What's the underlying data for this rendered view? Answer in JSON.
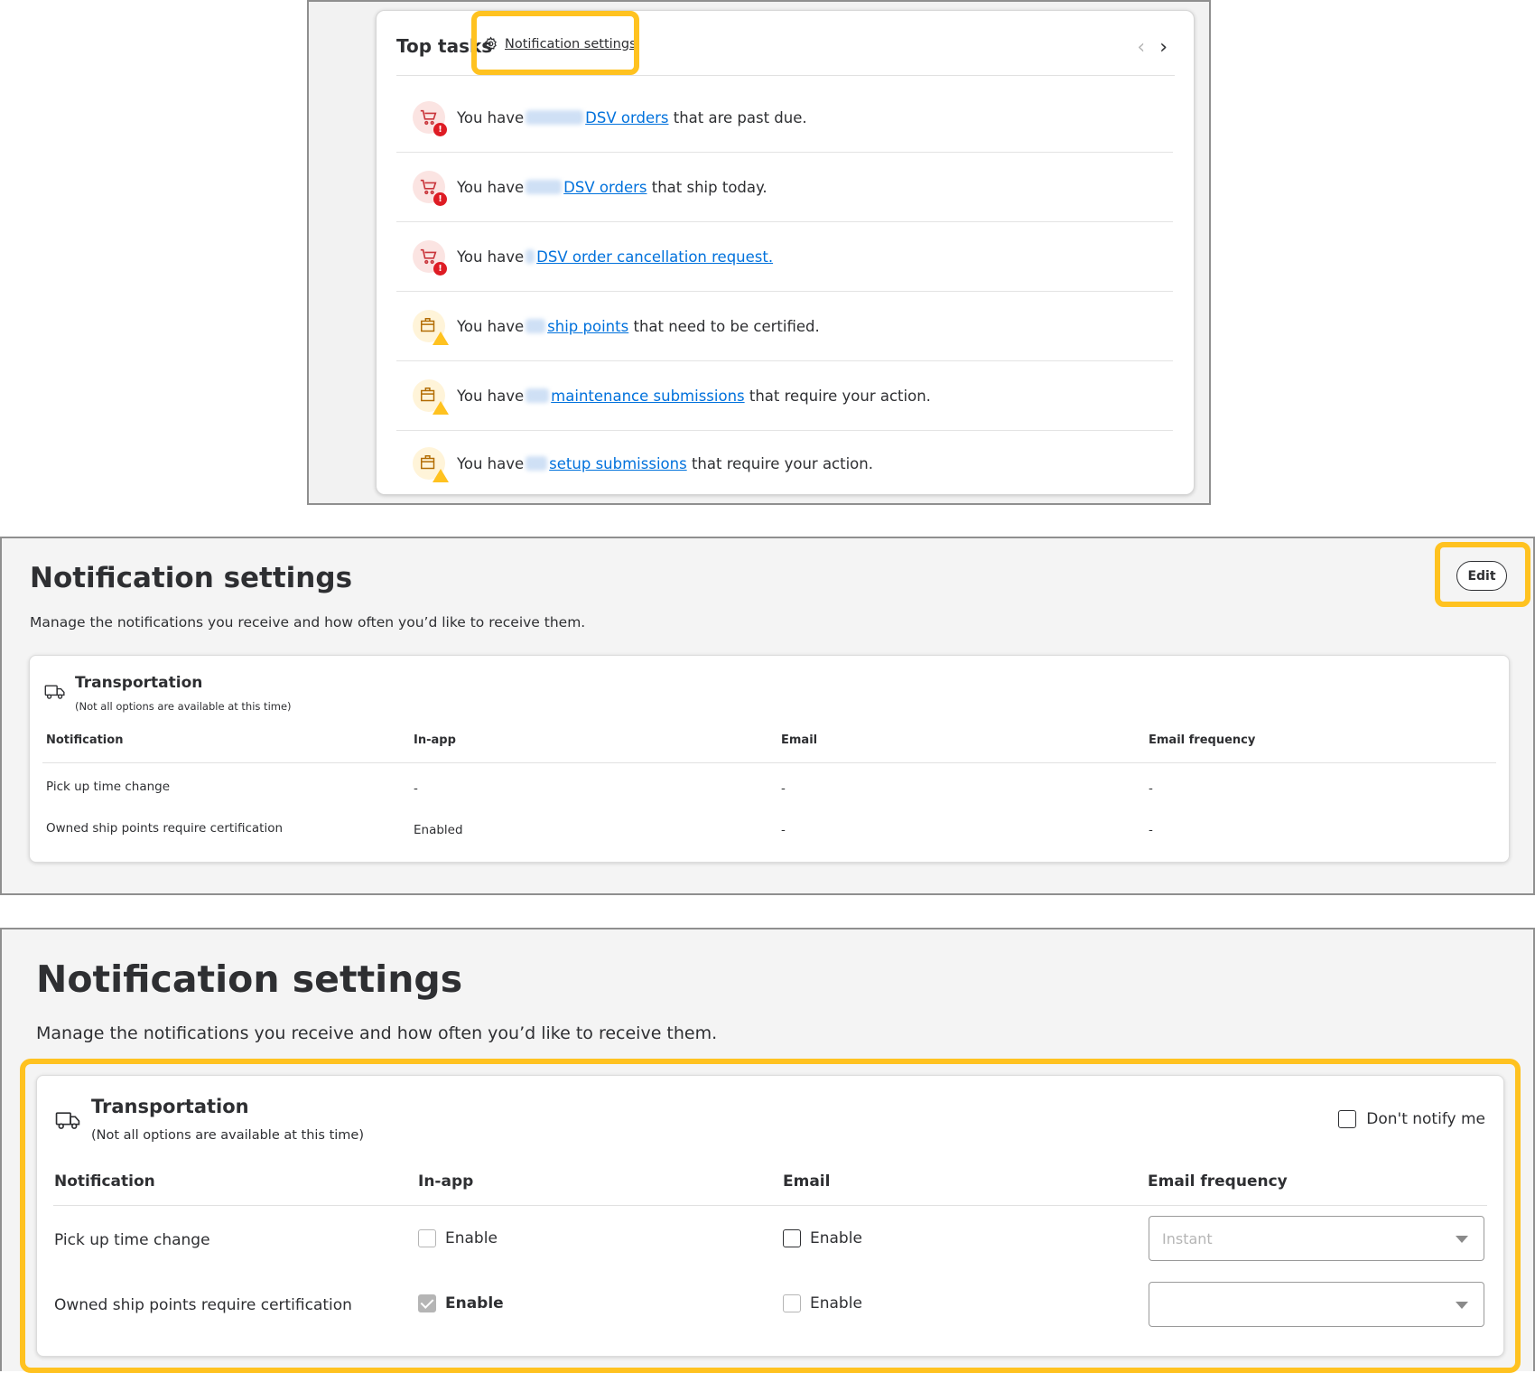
{
  "top_tasks": {
    "title": "Top tasks",
    "settings_link": "Notification settings",
    "nav_prev": "‹",
    "nav_next": "›",
    "tasks": [
      {
        "icon": "cart-alert-icon",
        "prefix": "You have",
        "link": "DSV orders",
        "suffix": "that are past due."
      },
      {
        "icon": "cart-alert-icon",
        "prefix": "You have",
        "link": "DSV orders",
        "suffix": "that ship today."
      },
      {
        "icon": "cart-alert-icon",
        "prefix": "You have",
        "link": "DSV order cancellation request.",
        "suffix": ""
      },
      {
        "icon": "box-warning-icon",
        "prefix": "You have",
        "link": "ship points",
        "suffix": "that need to be certified."
      },
      {
        "icon": "box-warning-icon",
        "prefix": "You have",
        "link": "maintenance submissions",
        "suffix": "that require your action."
      },
      {
        "icon": "box-warning-icon",
        "prefix": "You have",
        "link": "setup submissions",
        "suffix": "that require your action."
      }
    ]
  },
  "settings_view": {
    "title": "Notification settings",
    "subtitle": "Manage the notifications you receive and how often you’d like to receive them.",
    "edit_label": "Edit",
    "section_title": "Transportation",
    "section_note": "(Not all options are available at this time)",
    "columns": [
      "Notification",
      "In-app",
      "Email",
      "Email frequency"
    ],
    "rows": [
      {
        "name": "Pick up time change",
        "in_app": "-",
        "email": "-",
        "frequency": "-"
      },
      {
        "name": "Owned ship points require certification",
        "in_app": "Enabled",
        "email": "-",
        "frequency": "-"
      }
    ]
  },
  "settings_edit": {
    "title": "Notification settings",
    "subtitle": "Manage the notifications you receive and how often you’d like to receive them.",
    "section_title": "Transportation",
    "section_note": "(Not all options are available at this time)",
    "dont_notify_label": "Don't notify me",
    "columns": [
      "Notification",
      "In-app",
      "Email",
      "Email frequency"
    ],
    "enable_label": "Enable",
    "rows": [
      {
        "name": "Pick up time change",
        "in_app_checked": false,
        "email_checked": false,
        "frequency": "Instant"
      },
      {
        "name": "Owned ship points require certification",
        "in_app_checked": true,
        "email_checked": false,
        "frequency": ""
      }
    ]
  },
  "colors": {
    "highlight": "#ffc220",
    "link": "#0071dc",
    "error": "#de1c24"
  }
}
